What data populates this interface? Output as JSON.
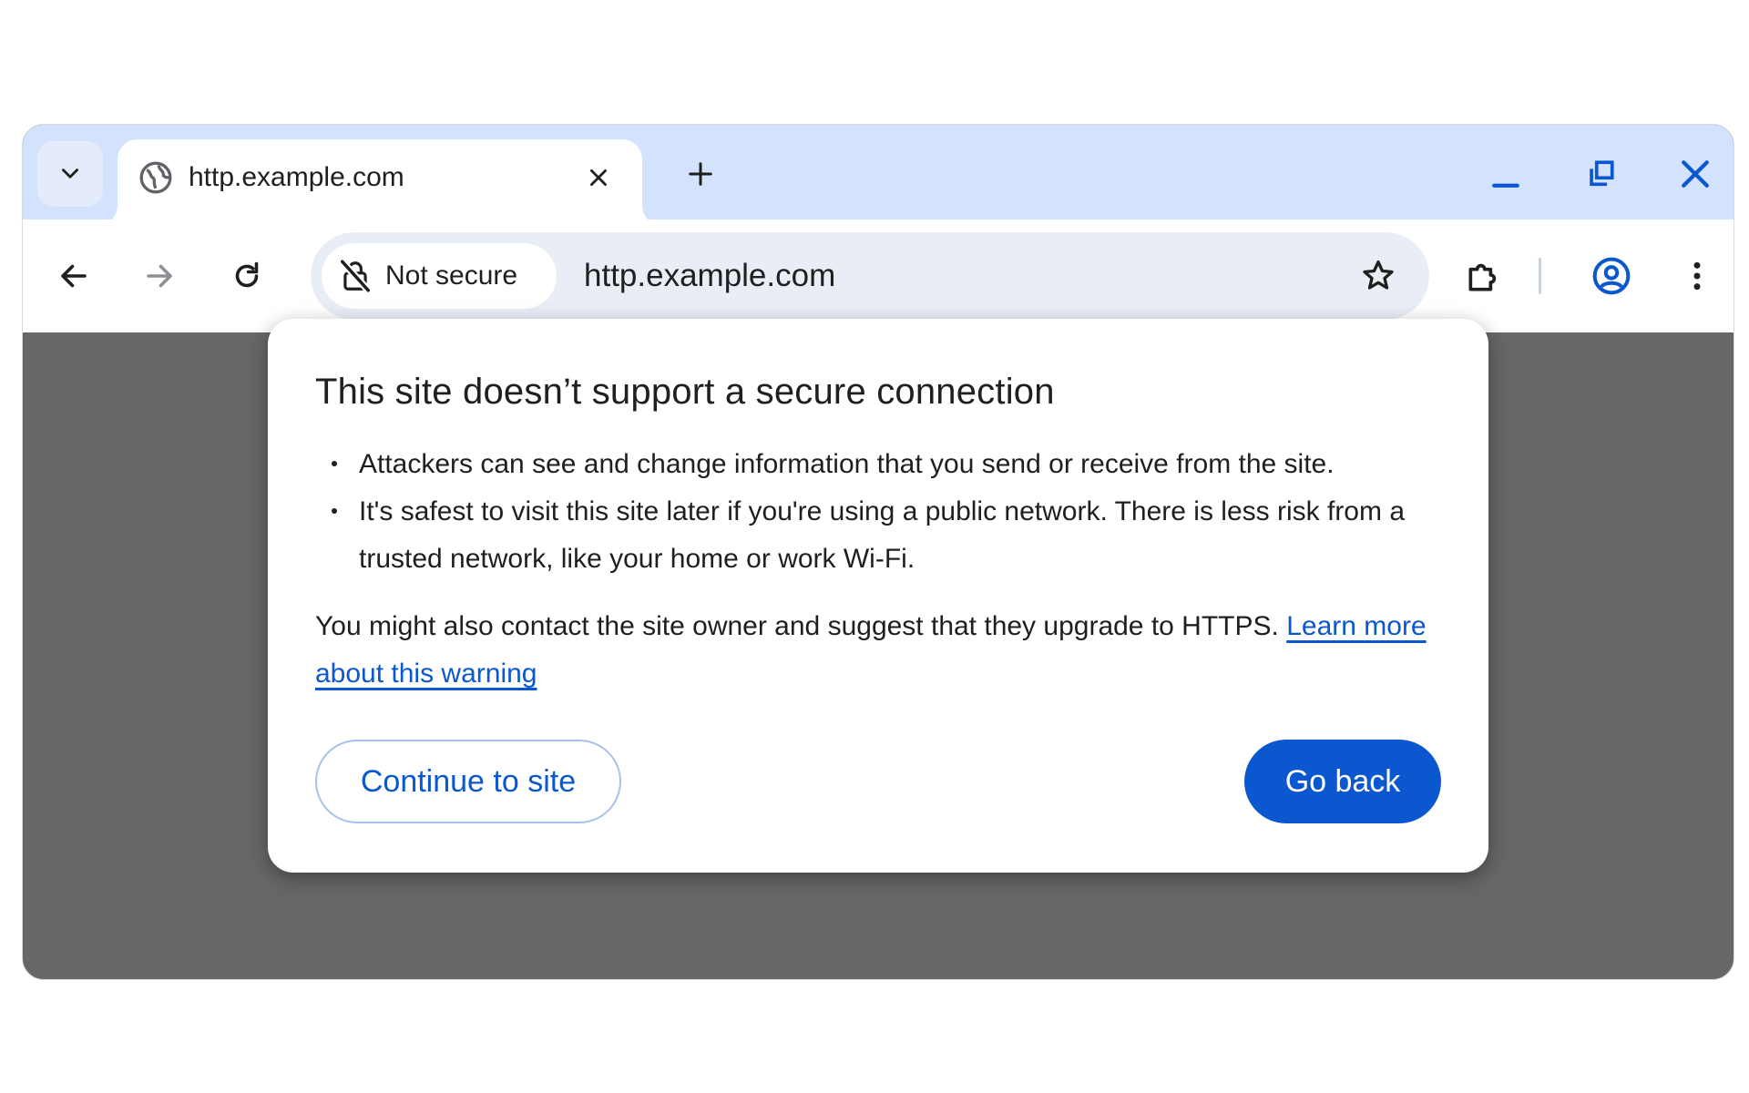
{
  "tab": {
    "title": "http.example.com"
  },
  "omnibox": {
    "security_label": "Not secure",
    "url": "http.example.com"
  },
  "dialog": {
    "title": "This site doesn’t support a secure connection",
    "bullets": [
      "Attackers can see and change information that you send or receive from the site.",
      "It's safest to visit this site later if you're using a public network. There is less risk from a trusted network, like your home or work Wi-Fi."
    ],
    "paragraph": "You might also contact the site owner and suggest that they upgrade to HTTPS.",
    "link_text": "Learn more about this warning",
    "continue_label": "Continue to site",
    "go_back_label": "Go back"
  },
  "colors": {
    "tabstrip": "#d3e3fd",
    "omnibox": "#e9eef6",
    "accent": "#0b57d0",
    "page_overlay": "#676767"
  },
  "icons": {
    "tab_search": "chevron-down-icon",
    "favicon": "globe-icon",
    "tab_close": "close-icon",
    "new_tab": "plus-icon",
    "minimize": "minimize-icon",
    "restore": "restore-icon",
    "window_close": "close-icon",
    "back": "back-arrow-icon",
    "forward": "forward-arrow-icon",
    "reload": "reload-icon",
    "security": "not-secure-lock-icon",
    "bookmark": "star-icon",
    "extensions": "puzzle-icon",
    "profile": "account-circle-icon",
    "menu": "more-vert-icon"
  }
}
